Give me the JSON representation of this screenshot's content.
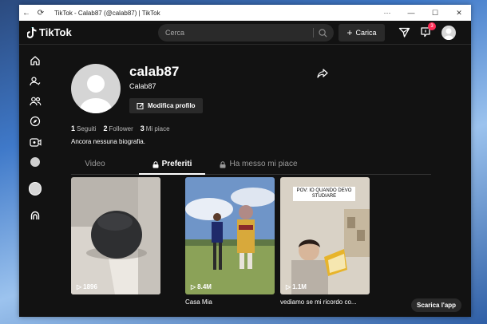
{
  "window": {
    "title": "TikTok - Calab87 (@calab87) | TikTok"
  },
  "topbar": {
    "logo_text": "TikTok",
    "search_placeholder": "Cerca",
    "upload_label": "Carica",
    "inbox_badge": "3"
  },
  "profile": {
    "username": "calab87",
    "nickname": "Calab87",
    "edit_label": "Modifica profilo",
    "stats": [
      {
        "count": "1",
        "label": "Seguiti"
      },
      {
        "count": "2",
        "label": "Follower"
      },
      {
        "count": "3",
        "label": "Mi piace"
      }
    ],
    "bio": "Ancora nessuna biografia."
  },
  "tabs": [
    {
      "label": "Video"
    },
    {
      "label": "Preferiti"
    },
    {
      "label": "Ha messo mi piace"
    }
  ],
  "videos": [
    {
      "views": "1896",
      "caption": ""
    },
    {
      "views": "8.4M",
      "caption": "Casa Mia"
    },
    {
      "views": "1.1M",
      "caption": "vediamo se mi ricordo co...",
      "overlay": "POV: IO QUANDO DEVO STUDIARE"
    }
  ],
  "get_app_label": "Scarica l'app",
  "colors": {
    "background": "#121212",
    "accent": "#fe2c55"
  }
}
